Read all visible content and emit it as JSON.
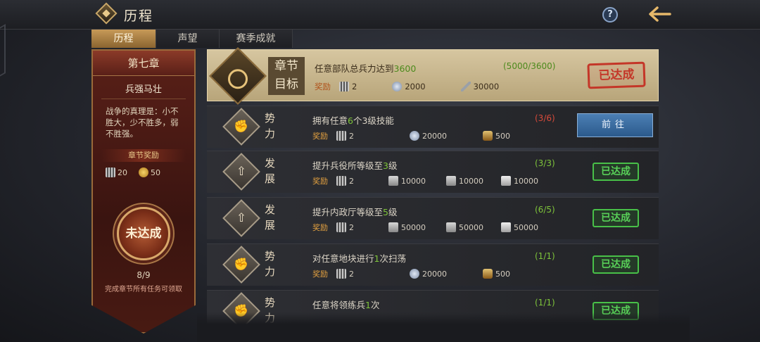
{
  "header": {
    "title": "历程"
  },
  "tabs": [
    "历程",
    "声望",
    "赛季成就"
  ],
  "chapter": {
    "number": "第七章",
    "name": "兵强马壮",
    "description": "战争的真理是：小不胜大，少不胜多，弱不胜强。",
    "reward_title": "章节奖励",
    "rewards": [
      {
        "icon": "troop-icon",
        "value": "20"
      },
      {
        "icon": "gold-coin-icon",
        "value": "50"
      }
    ],
    "status": "未达成",
    "progress": "8/9",
    "note": "完成章节所有任务可领取"
  },
  "goal": {
    "label_line1": "章节",
    "label_line2": "目标",
    "task_prefix": "任意部队总兵力达到",
    "task_value": "3600",
    "progress": "(5000/3600)",
    "reward_label": "奖励",
    "rewards": [
      {
        "icon": "troop-icon",
        "value": "2"
      },
      {
        "icon": "silver-coin-icon",
        "value": "2000"
      },
      {
        "icon": "feather-icon",
        "value": "30000"
      }
    ],
    "status": "已达成"
  },
  "tasks": [
    {
      "icon": "fist",
      "category": "势力",
      "desc_prefix": "拥有任意",
      "desc_hl": "6",
      "desc_mid": "个3级技能",
      "desc_hl2": "",
      "desc_suffix": "",
      "progress": "(3/6)",
      "progress_color": "red",
      "rewards": [
        {
          "icon": "troop-icon",
          "value": "2"
        },
        {
          "icon": "silver-coin-icon",
          "value": "20000"
        },
        {
          "icon": "shield-icon",
          "value": "500"
        }
      ],
      "action": "前往"
    },
    {
      "icon": "arrow",
      "category": "发展",
      "desc_prefix": "提升兵役所等级至",
      "desc_hl": "3",
      "desc_mid": "级",
      "desc_hl2": "",
      "desc_suffix": "",
      "progress": "(3/3)",
      "progress_color": "green",
      "rewards": [
        {
          "icon": "troop-icon",
          "value": "2"
        },
        {
          "icon": "stone-icon",
          "value": "10000"
        },
        {
          "icon": "ore-icon",
          "value": "10000"
        },
        {
          "icon": "iron-icon",
          "value": "10000"
        }
      ],
      "action": "已达成"
    },
    {
      "icon": "arrow",
      "category": "发展",
      "desc_prefix": "提升内政厅等级至",
      "desc_hl": "5",
      "desc_mid": "级",
      "desc_hl2": "",
      "desc_suffix": "",
      "progress": "(6/5)",
      "progress_color": "green",
      "rewards": [
        {
          "icon": "troop-icon",
          "value": "2"
        },
        {
          "icon": "stone-icon",
          "value": "50000"
        },
        {
          "icon": "ore-icon",
          "value": "50000"
        },
        {
          "icon": "iron-icon",
          "value": "50000"
        }
      ],
      "action": "已达成"
    },
    {
      "icon": "fist",
      "category": "势力",
      "desc_prefix": "对任意地块进行",
      "desc_hl": "1",
      "desc_mid": "次扫荡",
      "desc_hl2": "",
      "desc_suffix": "",
      "progress": "(1/1)",
      "progress_color": "green",
      "rewards": [
        {
          "icon": "troop-icon",
          "value": "2"
        },
        {
          "icon": "silver-coin-icon",
          "value": "20000"
        },
        {
          "icon": "shield-icon",
          "value": "500"
        }
      ],
      "action": "已达成"
    },
    {
      "icon": "fist",
      "category": "势力",
      "desc_prefix": "任意将领练兵",
      "desc_hl": "1",
      "desc_mid": "次",
      "desc_hl2": "",
      "desc_suffix": "",
      "progress": "(1/1)",
      "progress_color": "green",
      "rewards": [],
      "action": "已达成"
    }
  ],
  "reward_label": "奖励"
}
